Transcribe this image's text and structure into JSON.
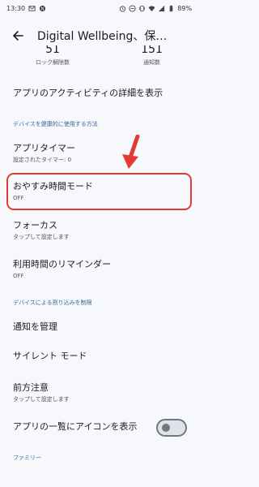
{
  "status_bar": {
    "time": "13:30",
    "battery": "89%"
  },
  "app_bar": {
    "title": "Digital Wellbeing、保護者による使用制限"
  },
  "stats": [
    {
      "value": "51",
      "label": "ロック解除数"
    },
    {
      "value": "151",
      "label": "通知数"
    }
  ],
  "rows": {
    "activity_details": {
      "title": "アプリのアクティビティの詳細を表示"
    },
    "section_healthy": "デバイスを健康的に使用する方法",
    "app_timer": {
      "title": "アプリタイマー",
      "subtitle": "設定されたタイマー: 0"
    },
    "bedtime_mode": {
      "title": "おやすみ時間モード",
      "subtitle": "OFF"
    },
    "focus": {
      "title": "フォーカス",
      "subtitle": "タップして設定します"
    },
    "usage_reminder": {
      "title": "利用時間のリマインダー",
      "subtitle": "OFF"
    },
    "section_interrupts": "デバイスによる割り込みを制限",
    "manage_notifications": {
      "title": "通知を管理"
    },
    "silent_mode": {
      "title": "サイレント モード"
    },
    "heads_up": {
      "title": "前方注意",
      "subtitle": "タップして設定します"
    },
    "show_icon": {
      "title": "アプリの一覧にアイコンを表示",
      "toggle_on": false
    },
    "section_family": "ファミリー"
  },
  "colors": {
    "highlight": "#e53935",
    "section_header": "#34699a"
  }
}
